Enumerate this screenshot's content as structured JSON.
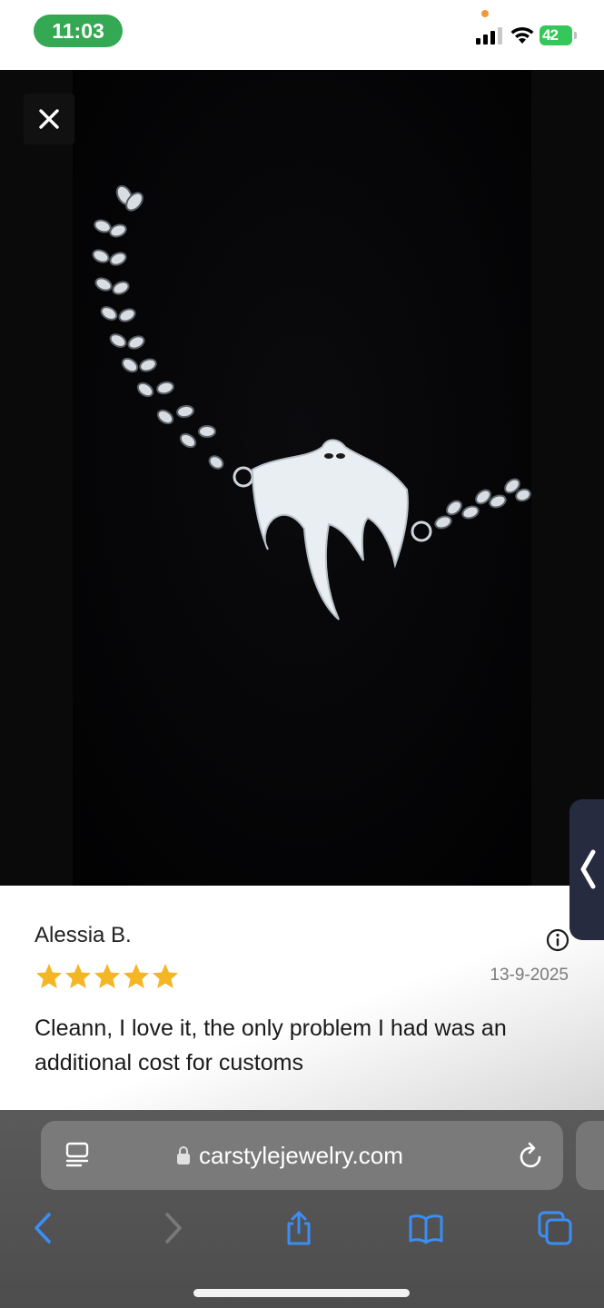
{
  "status_bar": {
    "time": "11:03",
    "battery_level": "42",
    "icons": [
      "signal-icon",
      "wifi-icon",
      "battery-charging-icon"
    ]
  },
  "photo_viewer": {
    "close_icon": "close-icon",
    "image": "ghost-pendant-chain-necklace"
  },
  "review": {
    "author": "Alessia B.",
    "rating": 5,
    "rating_max": 5,
    "date": "13-9-2025",
    "text": "Cleann, I love it, the only problem I had was an additional cost for customs",
    "info_icon": "info-icon",
    "star_color": "#f4b625"
  },
  "side_tab": {
    "icon": "chevron-left-icon"
  },
  "browser": {
    "url": "carstylejewelry.com",
    "icons": [
      "reader-mode-icon",
      "lock-icon",
      "reload-icon"
    ],
    "toolbar": [
      "back-icon",
      "forward-icon",
      "share-icon",
      "bookmarks-icon",
      "tabs-icon"
    ],
    "accent_color": "#3a8ef6"
  }
}
